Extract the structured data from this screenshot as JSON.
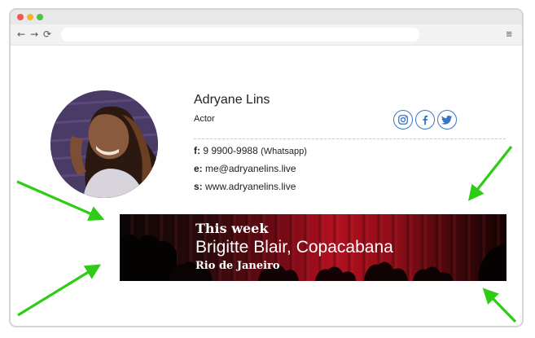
{
  "browser": {
    "back_icon": "←",
    "forward_icon": "→",
    "reload_icon": "⟳",
    "menu_icon": "≡"
  },
  "signature": {
    "name": "Adryane Lins",
    "role": "Actor",
    "phone_label": "f:",
    "phone": "9 9900-9988",
    "phone_note": "(Whatsapp)",
    "email_label": "e:",
    "email": "me@adryanelins.live",
    "site_label": "s:",
    "site": "www.adryanelins.live",
    "social": [
      "instagram-icon",
      "facebook-icon",
      "twitter-icon"
    ],
    "accent_color": "#3a74c9"
  },
  "banner": {
    "line1": "This week",
    "line2": "Brigitte Blair, Copacabana",
    "line3": "Rio de Janeiro"
  },
  "annotation": {
    "arrow_color": "#2ecc14"
  }
}
